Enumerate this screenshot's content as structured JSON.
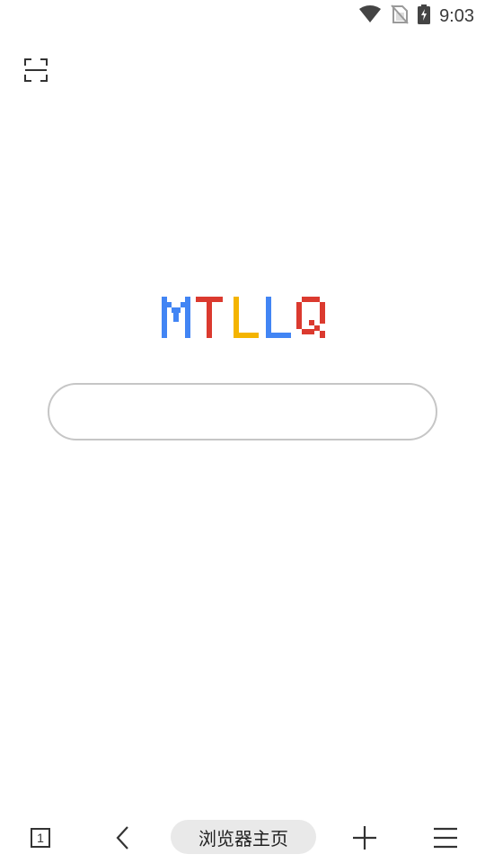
{
  "status_bar": {
    "time": "9:03",
    "icons": [
      "wifi-icon",
      "no-sim-icon",
      "battery-charging-icon"
    ]
  },
  "toolbar_top": {
    "scan_icon": "scan-icon"
  },
  "logo": {
    "text": "MTLLQ",
    "letter_colors": [
      "#4285F4",
      "#DB3A2F",
      "#F4B400",
      "#4285F4",
      "#DB3A2F"
    ]
  },
  "search": {
    "value": "",
    "placeholder": ""
  },
  "bottom_bar": {
    "tab_count": "1",
    "home_label": "浏览器主页",
    "back_icon": "back-chevron-icon",
    "add_icon": "plus-icon",
    "menu_icon": "menu-icon"
  },
  "colors": {
    "border": "#c6c6c6",
    "pill_bg": "#e9e9e9",
    "icon": "#333333"
  }
}
